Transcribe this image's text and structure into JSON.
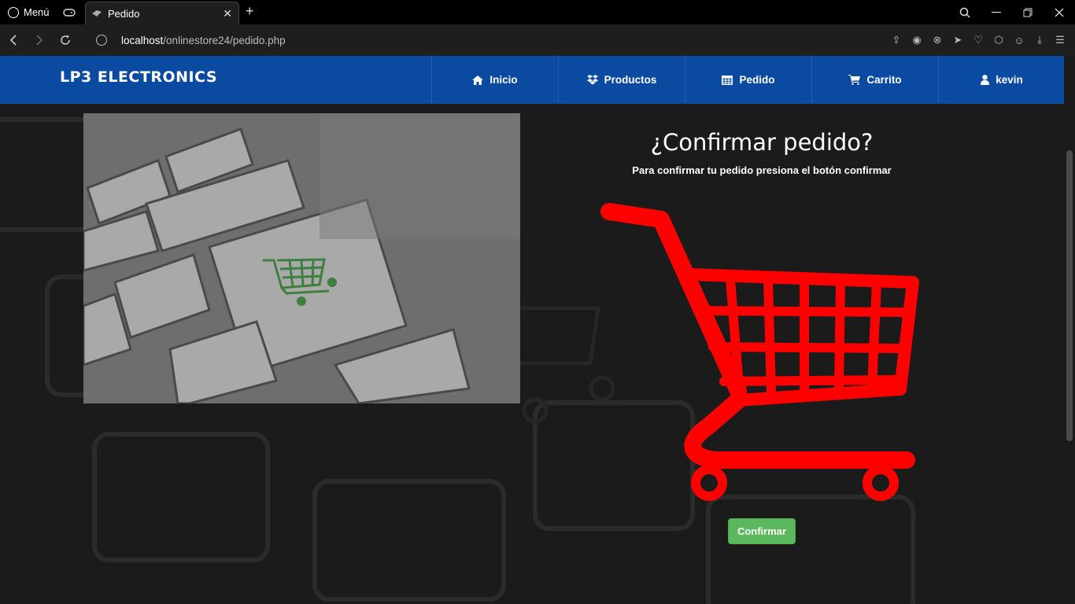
{
  "browser": {
    "menu_label": "Menú",
    "tab_title": "Pedido",
    "tab_close": "✕",
    "new_tab": "+",
    "url_host": "localhost",
    "url_path": "/onlinestore24/pedido.php"
  },
  "site": {
    "brand": "LP3 ELECTRONICS",
    "nav": [
      {
        "label": "Inicio",
        "icon": "home-icon"
      },
      {
        "label": "Productos",
        "icon": "dropbox-icon"
      },
      {
        "label": "Pedido",
        "icon": "table-icon"
      },
      {
        "label": "Carrito",
        "icon": "cart-icon"
      },
      {
        "label": "kevin",
        "icon": "user-icon"
      }
    ]
  },
  "main": {
    "title": "¿Confirmar pedido?",
    "subtitle": "Para confirmar tu pedido presiona el botón confirmar",
    "confirm_label": "Confirmar"
  },
  "colors": {
    "nav_bg": "#0a4aa1",
    "cart_red": "#ff0000",
    "button_green": "#5cb85c"
  }
}
